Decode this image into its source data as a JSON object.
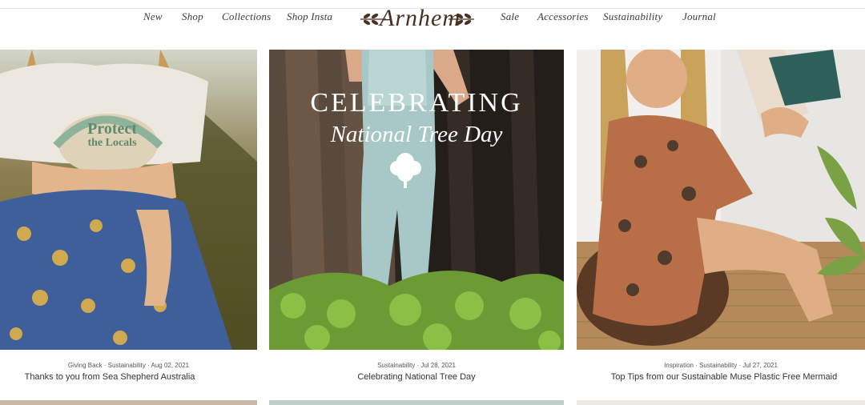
{
  "nav": {
    "left": [
      "New",
      "Shop",
      "Collections",
      "Shop Insta"
    ],
    "brand": "Arnhem",
    "right": [
      "Sale",
      "Accessories",
      "Sustainability",
      "Journal"
    ]
  },
  "posts": [
    {
      "meta": "Giving Back · Sustainability · Aug 02, 2021",
      "title": "Thanks to you from Sea Shepherd Australia",
      "shirt_text_1": "Protect",
      "shirt_text_2": "the Locals"
    },
    {
      "meta": "Sustainability · Jul 28, 2021",
      "title": "Celebrating National Tree Day",
      "overlay_line_1": "CELEBRATING",
      "overlay_line_2": "National Tree Day"
    },
    {
      "meta": "Inspiration · Sustainability · Jul 27, 2021",
      "title": "Top Tips from our Sustainable Muse Plastic Free Mermaid"
    }
  ]
}
